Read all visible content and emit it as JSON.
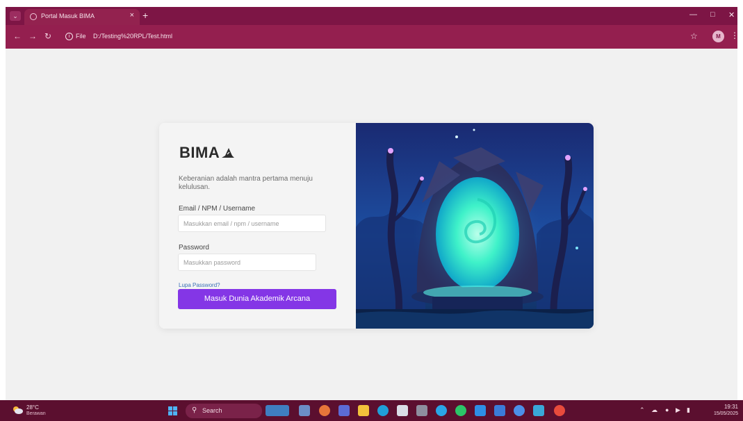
{
  "browser": {
    "tab_title": "Portal Masuk BIMA",
    "tab_close": "×",
    "newtab": "+",
    "url_scheme": "File",
    "url": "D:/Testing%20RPL/Test.html",
    "profile_initial": "M",
    "icons": {
      "menu": "chevron-down-icon",
      "back": "arrow-left-icon",
      "forward": "arrow-right-icon",
      "reload": "reload-icon",
      "info": "info-icon",
      "bookmark": "star-icon",
      "more": "kebab-icon"
    },
    "colors": {
      "tabstrip": "#7d1545",
      "toolbar": "#941f4f"
    }
  },
  "login": {
    "brand": "BIMA",
    "tagline": "Keberanian adalah mantra pertama menuju kelulusan.",
    "email_label": "Email / NPM / Username",
    "email_placeholder": "Masukkan email / npm / username",
    "password_label": "Password",
    "password_placeholder": "Masukkan password",
    "forgot": "Lupa Password?",
    "submit": "Masuk Dunia Akademik Arcana",
    "colors": {
      "button": "#8436e6",
      "link": "#3a6fb5",
      "portal_glow": "#3ff2c9"
    }
  },
  "taskbar": {
    "weather_temp": "28°C",
    "weather_desc": "Berawan",
    "search": "Search",
    "time": "19:31",
    "date": "15/05/2025",
    "colors": {
      "background": "#5b0f2f"
    }
  }
}
